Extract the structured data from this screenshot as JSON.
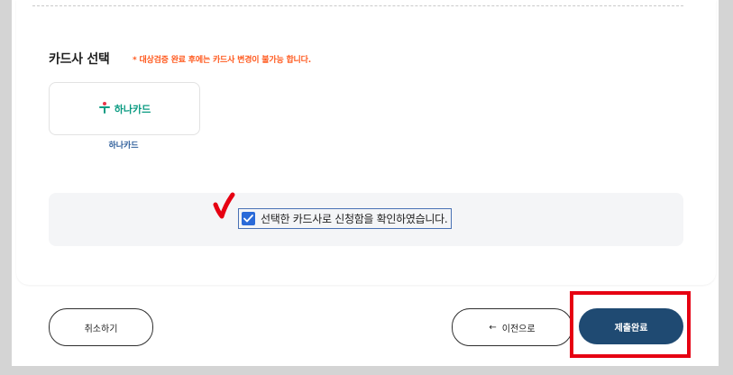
{
  "section": {
    "title": "카드사 선택",
    "note": "* 대상검증 완료 후에는 카드사 변경이 불가능 합니다."
  },
  "card_option": {
    "logo_text": "하나카드",
    "caption": "하나카드",
    "logo_icon": "hana-logo-icon"
  },
  "confirm": {
    "checked": true,
    "label": "선택한 카드사로 신청함을 확인하였습니다."
  },
  "buttons": {
    "cancel": "취소하기",
    "prev_arrow": "←",
    "prev": "이전으로",
    "submit": "제출완료"
  },
  "colors": {
    "accent": "#1f4a72",
    "note": "#ff5a1f",
    "highlight": "#e60012",
    "hana": "#0b9b82",
    "checkbox": "#2a6ad8"
  }
}
